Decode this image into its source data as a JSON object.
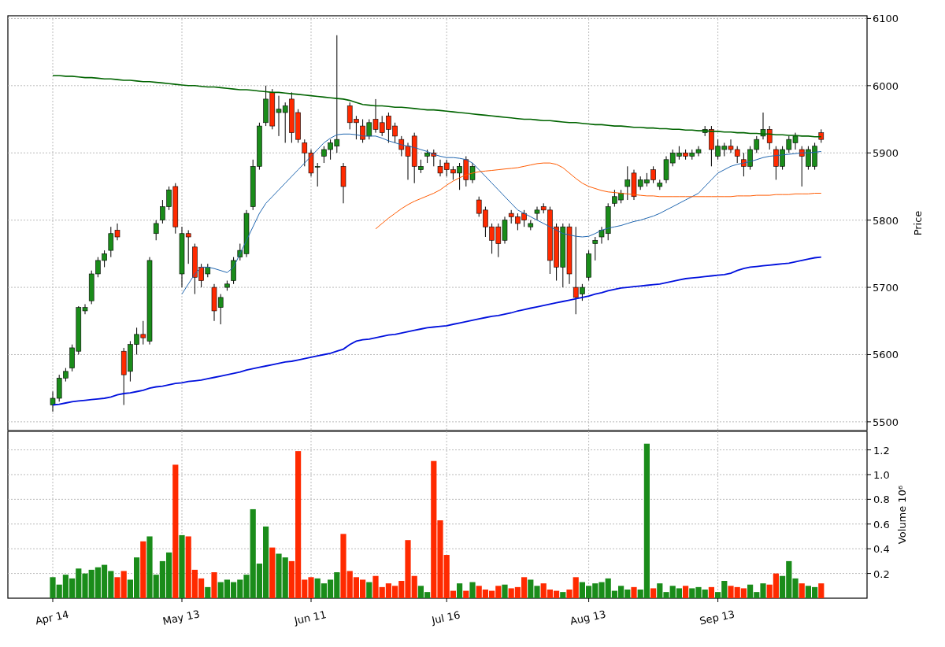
{
  "price_panel": {
    "chart_data": {
      "type": "candlestick",
      "ylabel": "Price",
      "ylim": [
        5487,
        6104
      ],
      "yticks": [
        5500,
        5600,
        5700,
        5800,
        5900,
        6000,
        6100
      ],
      "grid": true,
      "ohlc": [
        [
          5525,
          5545,
          5515,
          5535
        ],
        [
          5535,
          5570,
          5530,
          5565
        ],
        [
          5565,
          5580,
          5560,
          5575
        ],
        [
          5580,
          5615,
          5575,
          5610
        ],
        [
          5605,
          5672,
          5600,
          5670
        ],
        [
          5665,
          5675,
          5660,
          5670
        ],
        [
          5680,
          5725,
          5675,
          5720
        ],
        [
          5720,
          5745,
          5715,
          5740
        ],
        [
          5740,
          5755,
          5730,
          5750
        ],
        [
          5755,
          5790,
          5745,
          5780
        ],
        [
          5785,
          5795,
          5770,
          5775
        ],
        [
          5605,
          5610,
          5525,
          5570
        ],
        [
          5575,
          5620,
          5560,
          5615
        ],
        [
          5615,
          5640,
          5600,
          5630
        ],
        [
          5630,
          5650,
          5615,
          5625
        ],
        [
          5620,
          5745,
          5615,
          5740
        ],
        [
          5780,
          5800,
          5770,
          5795
        ],
        [
          5800,
          5830,
          5795,
          5820
        ],
        [
          5820,
          5850,
          5815,
          5845
        ],
        [
          5850,
          5855,
          5780,
          5790
        ],
        [
          5720,
          5790,
          5700,
          5780
        ],
        [
          5780,
          5785,
          5735,
          5775
        ],
        [
          5760,
          5765,
          5690,
          5715
        ],
        [
          5730,
          5735,
          5700,
          5710
        ],
        [
          5720,
          5735,
          5715,
          5730
        ],
        [
          5700,
          5705,
          5650,
          5665
        ],
        [
          5670,
          5690,
          5645,
          5685
        ],
        [
          5700,
          5710,
          5695,
          5705
        ],
        [
          5710,
          5745,
          5705,
          5740
        ],
        [
          5745,
          5765,
          5740,
          5755
        ],
        [
          5750,
          5815,
          5745,
          5810
        ],
        [
          5820,
          5890,
          5815,
          5880
        ],
        [
          5880,
          5945,
          5875,
          5940
        ],
        [
          5945,
          6000,
          5940,
          5980
        ],
        [
          5990,
          5995,
          5935,
          5940
        ],
        [
          5960,
          5985,
          5925,
          5965
        ],
        [
          5960,
          5975,
          5915,
          5970
        ],
        [
          5980,
          5990,
          5915,
          5930
        ],
        [
          5960,
          5965,
          5915,
          5920
        ],
        [
          5915,
          5920,
          5880,
          5900
        ],
        [
          5900,
          5905,
          5865,
          5870
        ],
        [
          5880,
          5885,
          5850,
          5880
        ],
        [
          5895,
          5910,
          5885,
          5905
        ],
        [
          5905,
          5920,
          5890,
          5915
        ],
        [
          5910,
          6075,
          5900,
          5920
        ],
        [
          5880,
          5885,
          5825,
          5850
        ],
        [
          5970,
          5975,
          5935,
          5945
        ],
        [
          5950,
          5955,
          5920,
          5945
        ],
        [
          5940,
          5950,
          5915,
          5920
        ],
        [
          5925,
          5950,
          5920,
          5945
        ],
        [
          5950,
          5980,
          5930,
          5935
        ],
        [
          5945,
          5955,
          5925,
          5930
        ],
        [
          5955,
          5960,
          5915,
          5935
        ],
        [
          5940,
          5945,
          5915,
          5925
        ],
        [
          5920,
          5925,
          5895,
          5905
        ],
        [
          5910,
          5915,
          5860,
          5895
        ],
        [
          5925,
          5930,
          5855,
          5880
        ],
        [
          5875,
          5890,
          5870,
          5880
        ],
        [
          5895,
          5905,
          5885,
          5900
        ],
        [
          5900,
          5905,
          5880,
          5895
        ],
        [
          5880,
          5890,
          5865,
          5870
        ],
        [
          5885,
          5890,
          5865,
          5875
        ],
        [
          5875,
          5880,
          5860,
          5870
        ],
        [
          5870,
          5885,
          5845,
          5880
        ],
        [
          5890,
          5895,
          5850,
          5860
        ],
        [
          5860,
          5885,
          5855,
          5880
        ],
        [
          5830,
          5835,
          5805,
          5810
        ],
        [
          5815,
          5820,
          5775,
          5790
        ],
        [
          5790,
          5795,
          5750,
          5770
        ],
        [
          5790,
          5795,
          5745,
          5765
        ],
        [
          5770,
          5805,
          5765,
          5800
        ],
        [
          5810,
          5815,
          5795,
          5805
        ],
        [
          5805,
          5810,
          5785,
          5795
        ],
        [
          5810,
          5815,
          5790,
          5800
        ],
        [
          5790,
          5800,
          5785,
          5795
        ],
        [
          5810,
          5820,
          5800,
          5815
        ],
        [
          5820,
          5825,
          5810,
          5815
        ],
        [
          5815,
          5820,
          5720,
          5740
        ],
        [
          5790,
          5795,
          5710,
          5730
        ],
        [
          5730,
          5795,
          5700,
          5790
        ],
        [
          5790,
          5795,
          5705,
          5720
        ],
        [
          5700,
          5790,
          5660,
          5685
        ],
        [
          5690,
          5705,
          5680,
          5700
        ],
        [
          5715,
          5755,
          5710,
          5750
        ],
        [
          5765,
          5775,
          5740,
          5770
        ],
        [
          5775,
          5790,
          5765,
          5785
        ],
        [
          5780,
          5825,
          5770,
          5820
        ],
        [
          5825,
          5845,
          5820,
          5835
        ],
        [
          5830,
          5845,
          5825,
          5840
        ],
        [
          5850,
          5880,
          5830,
          5860
        ],
        [
          5870,
          5875,
          5830,
          5835
        ],
        [
          5850,
          5865,
          5845,
          5860
        ],
        [
          5855,
          5870,
          5850,
          5860
        ],
        [
          5875,
          5880,
          5855,
          5860
        ],
        [
          5850,
          5860,
          5845,
          5855
        ],
        [
          5860,
          5895,
          5855,
          5890
        ],
        [
          5885,
          5905,
          5880,
          5900
        ],
        [
          5895,
          5910,
          5890,
          5900
        ],
        [
          5900,
          5905,
          5890,
          5895
        ],
        [
          5895,
          5905,
          5890,
          5900
        ],
        [
          5900,
          5910,
          5895,
          5905
        ],
        [
          5930,
          5940,
          5925,
          5935
        ],
        [
          5935,
          5940,
          5880,
          5905
        ],
        [
          5895,
          5920,
          5890,
          5910
        ],
        [
          5905,
          5915,
          5895,
          5910
        ],
        [
          5910,
          5920,
          5900,
          5905
        ],
        [
          5905,
          5910,
          5885,
          5895
        ],
        [
          5890,
          5900,
          5865,
          5880
        ],
        [
          5880,
          5910,
          5875,
          5905
        ],
        [
          5905,
          5925,
          5900,
          5920
        ],
        [
          5925,
          5960,
          5920,
          5935
        ],
        [
          5935,
          5940,
          5905,
          5915
        ],
        [
          5905,
          5910,
          5860,
          5880
        ],
        [
          5880,
          5910,
          5875,
          5905
        ],
        [
          5905,
          5925,
          5900,
          5920
        ],
        [
          5915,
          5930,
          5905,
          5925
        ],
        [
          5905,
          5910,
          5850,
          5895
        ],
        [
          5880,
          5910,
          5875,
          5905
        ],
        [
          5880,
          5915,
          5875,
          5910
        ],
        [
          5930,
          5935,
          5915,
          5920
        ]
      ],
      "series": [
        {
          "type": "line",
          "color": "#006400",
          "values": [
            6015,
            6015,
            6014,
            6014,
            6013,
            6012,
            6012,
            6011,
            6010,
            6010,
            6009,
            6008,
            6008,
            6007,
            6006,
            6006,
            6005,
            6004,
            6003,
            6002,
            6001,
            6000,
            6000,
            5999,
            5998,
            5998,
            5997,
            5996,
            5995,
            5994,
            5994,
            5993,
            5992,
            5991,
            5990,
            5990,
            5989,
            5988,
            5987,
            5986,
            5985,
            5984,
            5983,
            5982,
            5981,
            5980,
            5978,
            5975,
            5972,
            5971,
            5970,
            5970,
            5969,
            5968,
            5968,
            5967,
            5966,
            5965,
            5964,
            5964,
            5963,
            5962,
            5961,
            5960,
            5959,
            5958,
            5957,
            5956,
            5955,
            5954,
            5953,
            5952,
            5951,
            5950,
            5950,
            5949,
            5948,
            5948,
            5947,
            5946,
            5945,
            5945,
            5944,
            5943,
            5942,
            5942,
            5941,
            5940,
            5940,
            5939,
            5938,
            5938,
            5937,
            5937,
            5936,
            5936,
            5935,
            5935,
            5934,
            5934,
            5933,
            5933,
            5932,
            5932,
            5931,
            5931,
            5930,
            5930,
            5929,
            5929,
            5928,
            5928,
            5927,
            5927,
            5926,
            5926,
            5925,
            5925,
            5924,
            5924
          ]
        },
        {
          "type": "line",
          "color": "#0010dd",
          "values": [
            5525,
            5526,
            5528,
            5530,
            5531,
            5532,
            5533,
            5534,
            5535,
            5537,
            5540,
            5542,
            5543,
            5545,
            5547,
            5550,
            5552,
            5553,
            5555,
            5557,
            5558,
            5560,
            5561,
            5562,
            5564,
            5566,
            5568,
            5570,
            5572,
            5574,
            5577,
            5579,
            5581,
            5583,
            5585,
            5587,
            5589,
            5590,
            5592,
            5594,
            5596,
            5598,
            5600,
            5602,
            5605,
            5608,
            5615,
            5620,
            5622,
            5623,
            5625,
            5627,
            5629,
            5630,
            5632,
            5634,
            5636,
            5638,
            5640,
            5641,
            5642,
            5643,
            5645,
            5647,
            5649,
            5651,
            5653,
            5655,
            5657,
            5658,
            5660,
            5662,
            5665,
            5667,
            5669,
            5671,
            5673,
            5675,
            5677,
            5679,
            5681,
            5683,
            5685,
            5687,
            5690,
            5692,
            5695,
            5697,
            5699,
            5700,
            5701,
            5702,
            5703,
            5704,
            5705,
            5707,
            5709,
            5711,
            5713,
            5714,
            5715,
            5716,
            5717,
            5718,
            5719,
            5721,
            5725,
            5728,
            5730,
            5731,
            5732,
            5733,
            5734,
            5735,
            5736,
            5738,
            5740,
            5742,
            5744,
            5745
          ]
        },
        {
          "type": "line",
          "color": "#1f66b0",
          "values": [
            null,
            null,
            null,
            null,
            null,
            null,
            null,
            null,
            null,
            null,
            null,
            null,
            null,
            null,
            null,
            null,
            null,
            null,
            null,
            null,
            5690,
            5705,
            5720,
            5730,
            5730,
            5728,
            5725,
            5722,
            5730,
            5750,
            5770,
            5790,
            5810,
            5825,
            5835,
            5845,
            5855,
            5865,
            5875,
            5885,
            5895,
            5905,
            5915,
            5922,
            5927,
            5928,
            5928,
            5927,
            5925,
            5925,
            5925,
            5922,
            5918,
            5915,
            5912,
            5910,
            5908,
            5905,
            5902,
            5898,
            5895,
            5893,
            5893,
            5892,
            5890,
            5885,
            5875,
            5865,
            5855,
            5845,
            5835,
            5825,
            5815,
            5810,
            5805,
            5800,
            5795,
            5790,
            5785,
            5780,
            5778,
            5776,
            5775,
            5776,
            5780,
            5785,
            5788,
            5790,
            5792,
            5795,
            5798,
            5800,
            5803,
            5806,
            5810,
            5815,
            5820,
            5825,
            5830,
            5835,
            5840,
            5850,
            5860,
            5870,
            5875,
            5880,
            5883,
            5885,
            5887,
            5890,
            5893,
            5895,
            5896,
            5897,
            5898,
            5899,
            5900,
            5900,
            5901,
            5902
          ]
        },
        {
          "type": "line",
          "color": "#ff5a00",
          "values": [
            null,
            null,
            null,
            null,
            null,
            null,
            null,
            null,
            null,
            null,
            null,
            null,
            null,
            null,
            null,
            null,
            null,
            null,
            null,
            null,
            null,
            null,
            null,
            null,
            null,
            null,
            null,
            null,
            null,
            null,
            null,
            null,
            null,
            null,
            null,
            null,
            null,
            null,
            null,
            null,
            null,
            null,
            null,
            null,
            null,
            null,
            null,
            null,
            null,
            null,
            5787,
            5795,
            5803,
            5810,
            5817,
            5823,
            5828,
            5832,
            5836,
            5840,
            5845,
            5852,
            5858,
            5863,
            5867,
            5870,
            5872,
            5873,
            5874,
            5875,
            5876,
            5877,
            5878,
            5880,
            5882,
            5884,
            5885,
            5885,
            5883,
            5878,
            5870,
            5862,
            5855,
            5850,
            5847,
            5844,
            5842,
            5841,
            5840,
            5839,
            5838,
            5837,
            5836,
            5836,
            5835,
            5835,
            5835,
            5835,
            5835,
            5835,
            5835,
            5835,
            5835,
            5835,
            5835,
            5835,
            5836,
            5836,
            5836,
            5837,
            5837,
            5837,
            5838,
            5838,
            5838,
            5839,
            5839,
            5839,
            5840,
            5840
          ]
        }
      ]
    }
  },
  "volume_panel": {
    "chart_data": {
      "type": "bar",
      "ylabel": "Volume 10⁶",
      "ylim": [
        0,
        1.35
      ],
      "grid": true,
      "yticks": [
        {
          "value": 0.2,
          "label": "0.2"
        },
        {
          "value": 0.4,
          "label": "0.4"
        },
        {
          "value": 0.6,
          "label": "0.6"
        },
        {
          "value": 0.8,
          "label": "0.8"
        },
        {
          "value": 1.0,
          "label": "1.0"
        },
        {
          "value": 1.2,
          "label": "1.2"
        }
      ],
      "categories": [
        "Apr 14",
        null,
        null,
        null,
        null,
        null,
        null,
        null,
        null,
        null,
        null,
        null,
        null,
        null,
        null,
        null,
        null,
        null,
        null,
        null,
        "May 13",
        null,
        null,
        null,
        null,
        null,
        null,
        null,
        null,
        null,
        null,
        null,
        null,
        null,
        null,
        null,
        null,
        null,
        null,
        null,
        "Jun 11",
        null,
        null,
        null,
        null,
        null,
        null,
        null,
        null,
        null,
        null,
        null,
        null,
        null,
        null,
        null,
        null,
        null,
        null,
        null,
        null,
        "Jul 16",
        null,
        null,
        null,
        null,
        null,
        null,
        null,
        null,
        null,
        null,
        null,
        null,
        null,
        null,
        null,
        null,
        null,
        null,
        null,
        null,
        null,
        "Aug 13",
        null,
        null,
        null,
        null,
        null,
        null,
        null,
        null,
        null,
        null,
        null,
        null,
        null,
        null,
        null,
        null,
        null,
        null,
        null,
        "Sep 13",
        null,
        null,
        null,
        null,
        null,
        null,
        null,
        null,
        null,
        null,
        null,
        null,
        null,
        null,
        null,
        null
      ],
      "series": [
        {
          "color": "#1a8c1a",
          "values": [
            0.17,
            0.11,
            0.19,
            0.16,
            0.24,
            0.2,
            0.23,
            0.25,
            0.27,
            0.22,
            null,
            null,
            0.15,
            0.33,
            null,
            0.5,
            0.19,
            0.3,
            0.37,
            null,
            0.51,
            null,
            null,
            null,
            0.09,
            null,
            0.13,
            0.15,
            0.13,
            0.15,
            0.19,
            0.72,
            0.28,
            0.58,
            null,
            0.36,
            0.33,
            null,
            null,
            null,
            null,
            0.16,
            0.12,
            0.15,
            0.21,
            null,
            null,
            null,
            null,
            0.13,
            null,
            null,
            null,
            null,
            null,
            null,
            null,
            0.1,
            0.05,
            null,
            null,
            null,
            null,
            0.12,
            null,
            0.13,
            null,
            null,
            null,
            null,
            0.11,
            null,
            null,
            null,
            0.15,
            0.1,
            null,
            null,
            null,
            0.05,
            null,
            null,
            0.13,
            0.1,
            0.12,
            0.13,
            0.16,
            0.06,
            0.1,
            0.07,
            null,
            0.07,
            1.25,
            null,
            0.12,
            0.05,
            0.1,
            0.08,
            null,
            0.08,
            0.09,
            0.07,
            null,
            0.05,
            0.14,
            null,
            null,
            null,
            0.11,
            0.05,
            0.12,
            null,
            null,
            0.18,
            0.3,
            0.16,
            null,
            0.1,
            0.09,
            null
          ]
        },
        {
          "color": "#ff2a00",
          "values": [
            null,
            null,
            null,
            null,
            null,
            null,
            null,
            null,
            null,
            null,
            0.17,
            0.22,
            null,
            null,
            0.46,
            null,
            null,
            null,
            null,
            1.08,
            null,
            0.5,
            0.23,
            0.16,
            null,
            0.21,
            null,
            null,
            null,
            null,
            null,
            null,
            null,
            null,
            0.41,
            null,
            null,
            0.3,
            1.19,
            0.15,
            0.17,
            null,
            null,
            null,
            null,
            0.52,
            0.22,
            0.17,
            0.15,
            null,
            0.18,
            0.09,
            0.12,
            0.1,
            0.14,
            0.47,
            0.18,
            null,
            null,
            1.11,
            0.63,
            0.35,
            0.06,
            null,
            0.06,
            null,
            0.1,
            0.07,
            0.06,
            0.1,
            null,
            0.08,
            0.09,
            0.17,
            null,
            null,
            0.12,
            0.07,
            0.06,
            null,
            0.07,
            0.17,
            null,
            null,
            null,
            null,
            null,
            null,
            null,
            null,
            0.09,
            null,
            null,
            0.08,
            null,
            null,
            null,
            null,
            0.1,
            null,
            null,
            null,
            0.09,
            null,
            null,
            0.1,
            0.09,
            0.08,
            null,
            null,
            null,
            0.11,
            0.2,
            null,
            null,
            null,
            0.12,
            null,
            null,
            0.12
          ]
        }
      ]
    }
  }
}
